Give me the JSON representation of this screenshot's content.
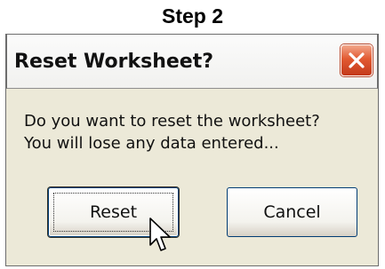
{
  "caption": "Step 2",
  "dialog": {
    "title": "Reset Worksheet?",
    "message_line1": "Do you want to reset the worksheet?",
    "message_line2": "You will lose any data entered...",
    "reset_label": "Reset",
    "cancel_label": "Cancel",
    "close_icon": "close-icon",
    "cursor_icon": "mouse-pointer-icon",
    "colors": {
      "close_button": "#e25a32",
      "dialog_background": "#ece9d8",
      "focus_border": "#003c74"
    }
  }
}
